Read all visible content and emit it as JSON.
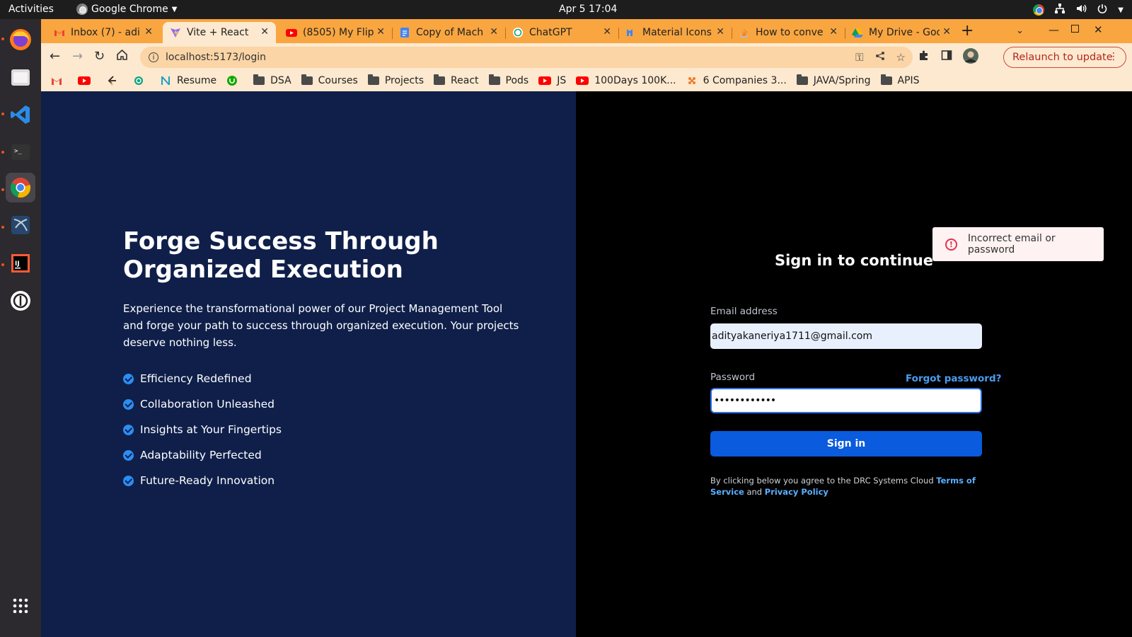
{
  "system": {
    "activities": "Activities",
    "app_name": "Google Chrome",
    "clock": "Apr 5  17:04"
  },
  "tabs": [
    {
      "title": "Inbox (7) - adi",
      "icon": "gmail-icon"
    },
    {
      "title": "Vite + React",
      "icon": "vite-icon",
      "active": true
    },
    {
      "title": "(8505) My Flip",
      "icon": "youtube-icon"
    },
    {
      "title": "Copy of Mach",
      "icon": "docs-icon"
    },
    {
      "title": "ChatGPT",
      "icon": "chatgpt-icon"
    },
    {
      "title": "Material Icons",
      "icon": "material-icon"
    },
    {
      "title": "How to conve",
      "icon": "stackoverflow-icon"
    },
    {
      "title": "My Drive - Goo",
      "icon": "drive-icon"
    }
  ],
  "toolbar": {
    "url": "localhost:5173/login",
    "relaunch": "Relaunch to update"
  },
  "bookmarks": [
    {
      "label": "",
      "icon": "gmail-icon"
    },
    {
      "label": "",
      "icon": "youtube-icon"
    },
    {
      "label": "",
      "icon": "leetcode-icon"
    },
    {
      "label": "",
      "icon": "chatgpt-icon"
    },
    {
      "label": "Resume",
      "icon": "notion-icon"
    },
    {
      "label": "",
      "icon": "upwork-icon"
    },
    {
      "label": "DSA",
      "icon": "folder-icon"
    },
    {
      "label": "Courses",
      "icon": "folder-icon"
    },
    {
      "label": "Projects",
      "icon": "folder-icon"
    },
    {
      "label": "React",
      "icon": "folder-icon"
    },
    {
      "label": "Pods",
      "icon": "folder-icon"
    },
    {
      "label": "JS",
      "icon": "youtube-icon"
    },
    {
      "label": "100Days 100K...",
      "icon": "youtube-icon"
    },
    {
      "label": "6 Companies 3...",
      "icon": "hackerrank-icon"
    },
    {
      "label": "JAVA/Spring",
      "icon": "folder-icon"
    },
    {
      "label": "APIS",
      "icon": "folder-icon"
    }
  ],
  "hero": {
    "title": "Forge Success Through Organized Execution",
    "description": "Experience the transformational power of our Project Management Tool and forge your path to success through organized execution. Your projects deserve nothing less.",
    "features": [
      "Efficiency Redefined",
      "Collaboration Unleashed",
      "Insights at Your Fingertips",
      "Adaptability Perfected",
      "Future-Ready Innovation"
    ]
  },
  "signin": {
    "title": "Sign in to continue",
    "email_label": "Email address",
    "email_value": "adityakaneriya1711@gmail.com",
    "password_label": "Password",
    "forgot": "Forgot password?",
    "password_value": "••••••••••••",
    "button": "Sign in",
    "terms_prefix": "By clicking below you agree to the DRC Systems Cloud ",
    "terms_link": "Terms of Service",
    "terms_and": " and ",
    "privacy_link": "Privacy Policy"
  },
  "toast": {
    "message": "Incorrect email or password"
  },
  "colors": {
    "tabstrip": "#f9a640",
    "left_pane": "#0f1f4a",
    "primary_button": "#0a5bdd",
    "link": "#4a9df0",
    "error": "#e0334c"
  }
}
